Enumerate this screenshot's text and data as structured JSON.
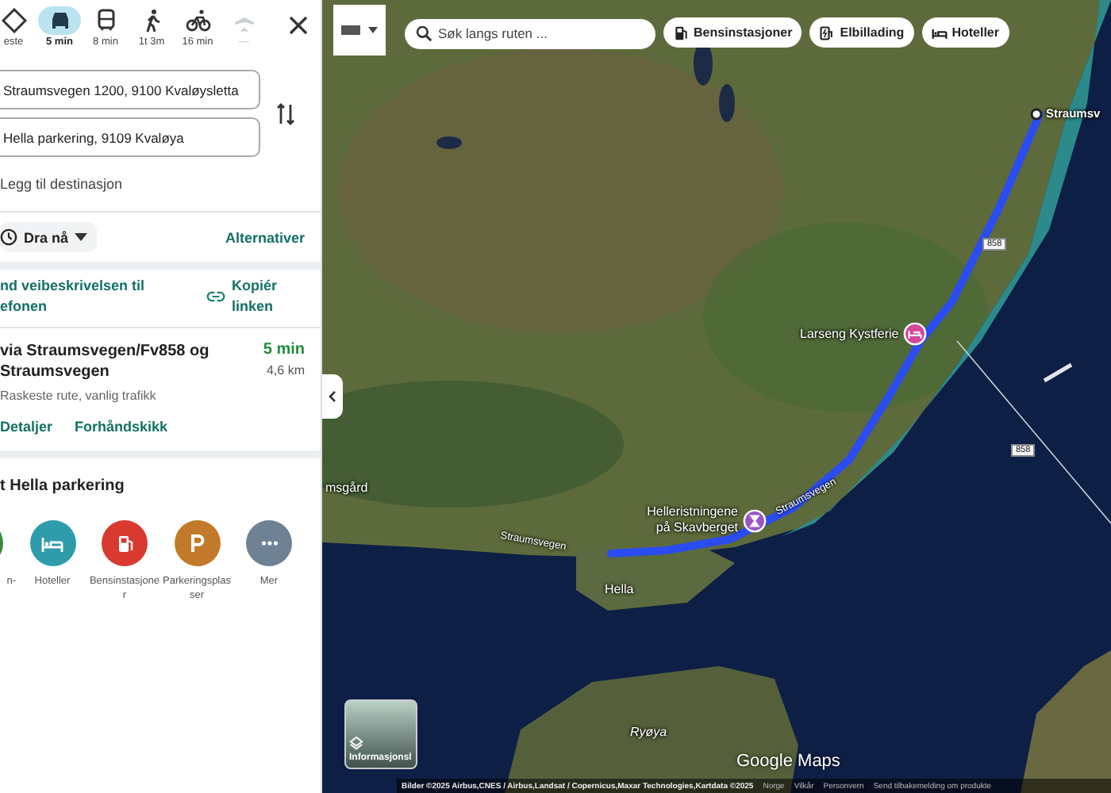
{
  "travel_modes": [
    {
      "kind": "best",
      "label": "este",
      "selected": false,
      "disabled": false
    },
    {
      "kind": "car",
      "label": "5 min",
      "selected": true,
      "disabled": false
    },
    {
      "kind": "transit",
      "label": "8 min",
      "selected": false,
      "disabled": false
    },
    {
      "kind": "walk",
      "label": "1t 3m",
      "selected": false,
      "disabled": false
    },
    {
      "kind": "bike",
      "label": "16 min",
      "selected": false,
      "disabled": false
    },
    {
      "kind": "flight",
      "label": "—",
      "selected": false,
      "disabled": true
    }
  ],
  "origin": "Straumsvegen 1200, 9100 Kvaløysletta",
  "destination": "Hella parkering, 9109 Kvaløya",
  "add_destination": "Legg til destinasjon",
  "depart": "Dra nå",
  "options": "Alternativer",
  "send_to_phone": "nd veibeskrivelsen til efonen",
  "copy_link": "Kopiér linken",
  "route": {
    "title": "via Straumsvegen/Fv858 og Straumsvegen",
    "duration": "5 min",
    "distance": "4,6 km",
    "note": "Raskeste rute, vanlig trafikk",
    "links": [
      "Detaljer",
      "Forhåndskikk"
    ]
  },
  "nearby": {
    "title": "t Hella parkering",
    "items": [
      {
        "kind": "ev",
        "label": "n-",
        "color": "#3a8a3e"
      },
      {
        "kind": "hotel",
        "label": "Hoteller",
        "color": "#2e9cab"
      },
      {
        "kind": "gas",
        "label": "Bensinstasjoner",
        "color": "#d93a30"
      },
      {
        "kind": "parking",
        "label": "Parkeringsplasser",
        "color": "#c27a2a"
      },
      {
        "kind": "more",
        "label": "Mer",
        "color": "#6e8294"
      }
    ]
  },
  "map": {
    "search_placeholder": "Søk langs ruten ...",
    "chips": [
      {
        "kind": "gas",
        "label": "Bensinstasjoner"
      },
      {
        "kind": "ev",
        "label": "Elbillading"
      },
      {
        "kind": "hotel",
        "label": "Hoteller"
      }
    ],
    "labels": [
      {
        "kind": "start",
        "text": "Straumsv"
      },
      {
        "kind": "hotel-pin",
        "text": "Larseng Kystferie"
      },
      {
        "kind": "poi-pin",
        "text": "Helleristningene på Skavberget"
      },
      {
        "kind": "road-a",
        "text": "Straumsvegen"
      },
      {
        "kind": "road-b",
        "text": "Straumsvegen"
      },
      {
        "kind": "shield-a",
        "text": "858"
      },
      {
        "kind": "shield-b",
        "text": "858"
      },
      {
        "kind": "place-hella",
        "text": "Hella"
      },
      {
        "kind": "place-west",
        "text": "msgård"
      },
      {
        "kind": "island",
        "text": "Ryøya"
      }
    ],
    "layers_label": "Informasjonsl",
    "brand": "Google Maps",
    "footer": [
      "Bilder ©2025 Airbus,CNES / Airbus,Landsat / Copernicus,Maxar Technologies,Kartdata ©2025",
      "Norge",
      "Vilkår",
      "Personvern",
      "Send tilbakemelding om produkte"
    ]
  }
}
